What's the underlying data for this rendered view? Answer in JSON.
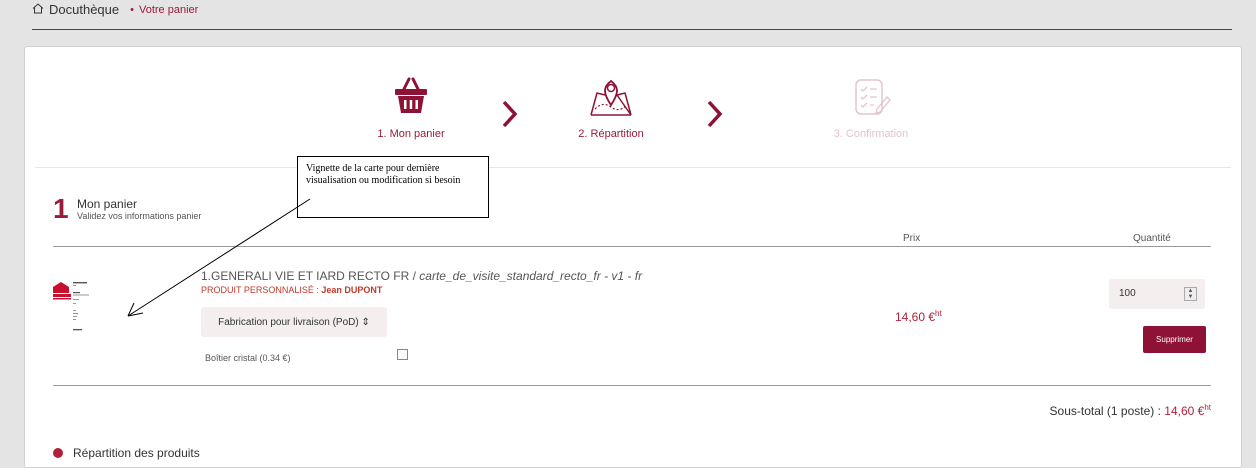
{
  "breadcrumb": {
    "home": "Docuthèque",
    "separator": "•",
    "current": "Votre panier"
  },
  "steps": [
    {
      "label": "1. Mon panier",
      "icon": "basket-icon",
      "state": "active"
    },
    {
      "label": "2. Répartition",
      "icon": "map-pin-icon",
      "state": "active"
    },
    {
      "label": "3. Confirmation",
      "icon": "checklist-icon",
      "state": "disabled"
    }
  ],
  "section": {
    "number": "1",
    "title": "Mon panier",
    "subtitle": "Validez vos informations panier"
  },
  "columns": {
    "price": "Prix",
    "quantity": "Quantité"
  },
  "item": {
    "name": "1.GENERALI VIE ET IARD RECTO FR",
    "sep": " / ",
    "ref": "carte_de_visite_standard_recto_fr - v1 - fr",
    "perso_label": "PRODUIT PERSONNALISÉ : ",
    "perso_name": "Jean DUPONT",
    "fabrication": "Fabrication pour livraison (PoD) ⇕",
    "option_label": "Boîtier cristal (0.34 €)",
    "price": "14,60 €",
    "price_sup": "ht",
    "quantity": "100",
    "delete_label": "Supprimer"
  },
  "subtotal": {
    "label": "Sous-total (1 poste) : ",
    "value": "14,60 €",
    "sup": "ht"
  },
  "next_section": {
    "title": "Répartition des produits"
  },
  "callout": {
    "text": "Vignette de la carte pour dernière visualisation ou modification si besoin"
  },
  "colors": {
    "brand": "#9b1c3a",
    "button": "#8e1235",
    "disabled": "#e2c5cc"
  }
}
